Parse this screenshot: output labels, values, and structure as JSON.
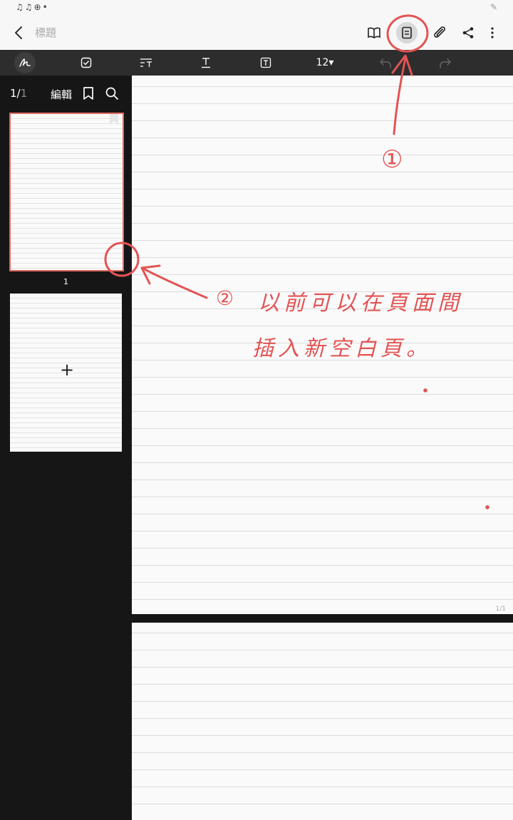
{
  "status_bar": {
    "icons": [
      "music-note-icon",
      "music-note-icon",
      "globe-icon",
      "dot-icon"
    ],
    "right_icon": "pen-icon"
  },
  "app_bar": {
    "title_placeholder": "標題",
    "buttons": [
      "book-icon",
      "page-list-icon",
      "attach-icon",
      "share-icon",
      "more-icon"
    ]
  },
  "toolbar": {
    "font_size": "12▾",
    "tools": [
      "handwriting-icon",
      "checkbox-icon",
      "text-format-icon",
      "text-underline-icon",
      "text-box-icon",
      "undo-icon",
      "redo-icon"
    ]
  },
  "sidebar": {
    "page_current": "1/",
    "page_total": "1",
    "edit_label": "編輯",
    "thumbnails": [
      {
        "label": "1",
        "selected": true
      }
    ],
    "add_page_symbol": "+"
  },
  "canvas": {
    "page_indicator": "1/1"
  },
  "annotations": {
    "color": "#e35454",
    "marker_1": "①",
    "marker_2": "②",
    "note_line1": "以前可以在頁面間",
    "note_line2": "插入新空白頁。"
  }
}
